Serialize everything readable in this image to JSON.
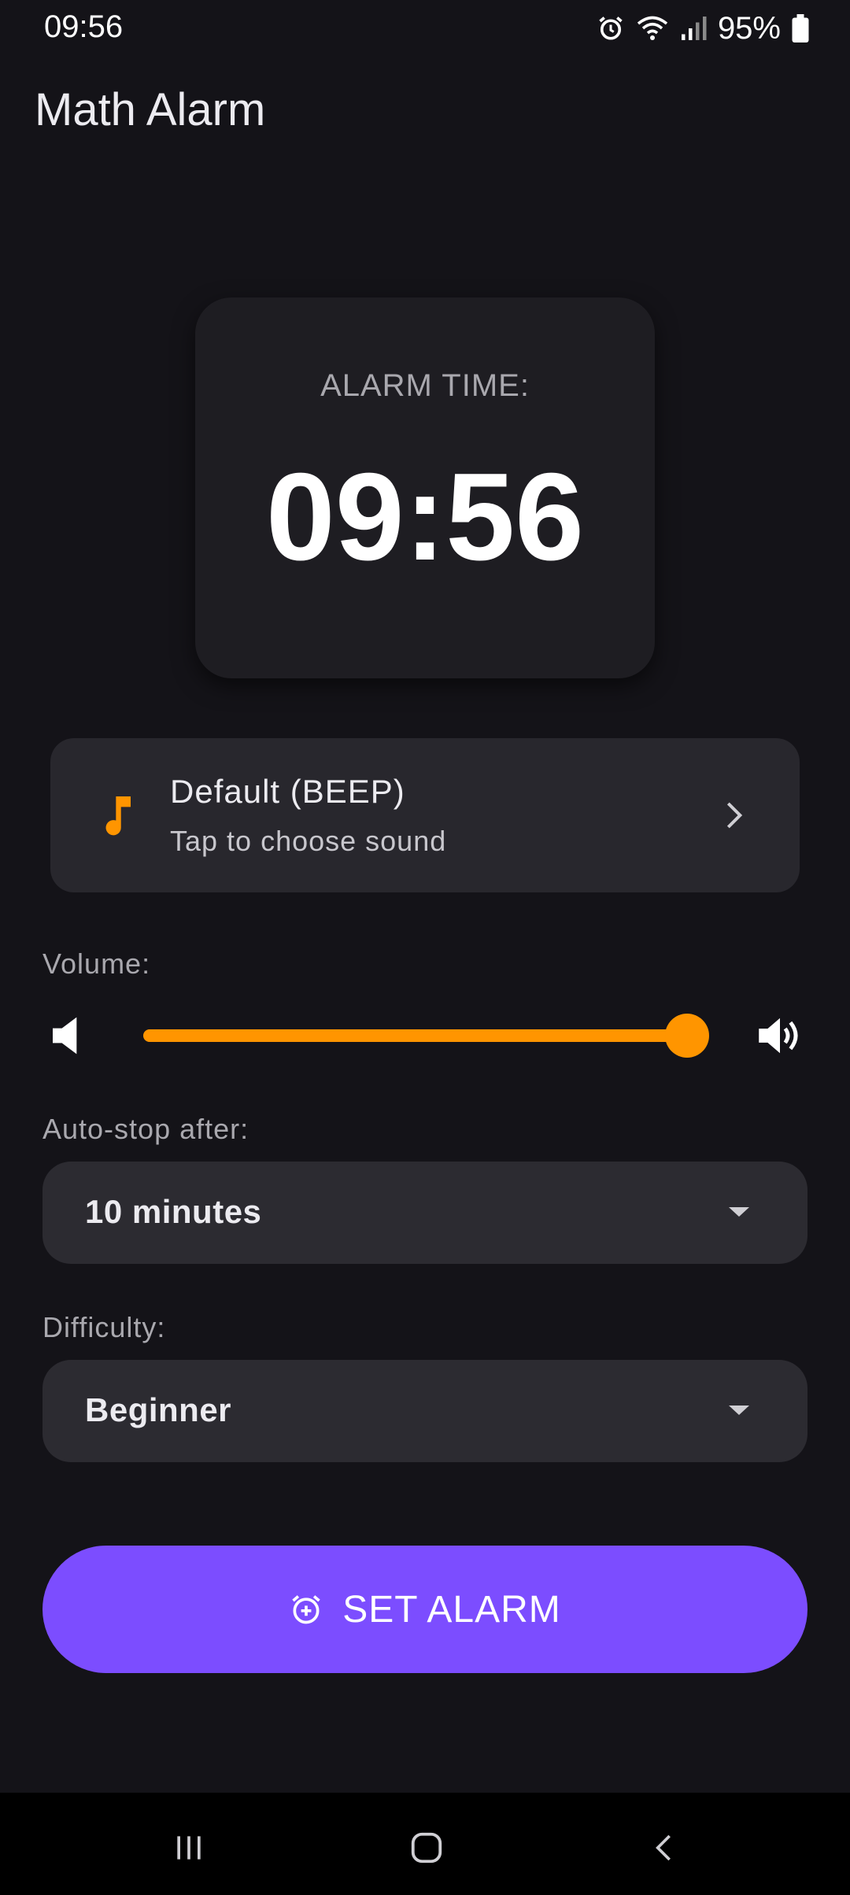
{
  "status_bar": {
    "time": "09:56",
    "battery_percent": "95%",
    "icons": [
      "alarm-icon",
      "wifi-icon",
      "signal-icon",
      "battery-icon"
    ]
  },
  "app_bar": {
    "title": "Math Alarm"
  },
  "alarm_card": {
    "label": "ALARM TIME:",
    "time": "09:56"
  },
  "sound": {
    "icon": "music-note-icon",
    "title": "Default (BEEP)",
    "subtitle": "Tap to choose sound",
    "chevron": "chevron-right-icon"
  },
  "volume": {
    "label": "Volume:",
    "value_fraction": 0.97,
    "low_icon": "volume-low-icon",
    "high_icon": "volume-high-icon"
  },
  "auto_stop": {
    "label": "Auto-stop after:",
    "value": "10 minutes"
  },
  "difficulty": {
    "label": "Difficulty:",
    "value": "Beginner"
  },
  "set_alarm": {
    "label": "SET ALARM",
    "icon": "alarm-add-icon"
  },
  "nav": {
    "items": [
      "recents-icon",
      "home-icon",
      "back-icon"
    ]
  },
  "colors": {
    "background": "#141318",
    "accent": "#FF9500",
    "primary_button": "#7C4DFF",
    "card": "#1E1D22"
  }
}
